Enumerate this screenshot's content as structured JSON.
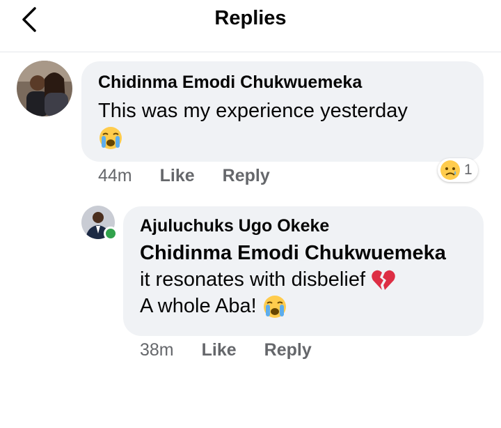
{
  "header": {
    "title": "Replies"
  },
  "comments": [
    {
      "author": "Chidinma Emodi Chukwuemeka",
      "lines": [
        "This was my experience yesterday"
      ],
      "time": "44m",
      "like_label": "Like",
      "reply_label": "Reply",
      "reaction": {
        "icon": "sad-emoji",
        "count": "1"
      }
    },
    {
      "author": "Ajuluchuks Ugo Okeke",
      "mention": "Chidinma Emodi Chukwuemeka",
      "lines": [
        "it resonates with disbelief",
        "A whole Aba!"
      ],
      "time": "38m",
      "like_label": "Like",
      "reply_label": "Reply",
      "online": true
    }
  ],
  "colors": {
    "bubble": "#f0f2f5",
    "meta_text": "#65676b",
    "online": "#31a24c"
  }
}
